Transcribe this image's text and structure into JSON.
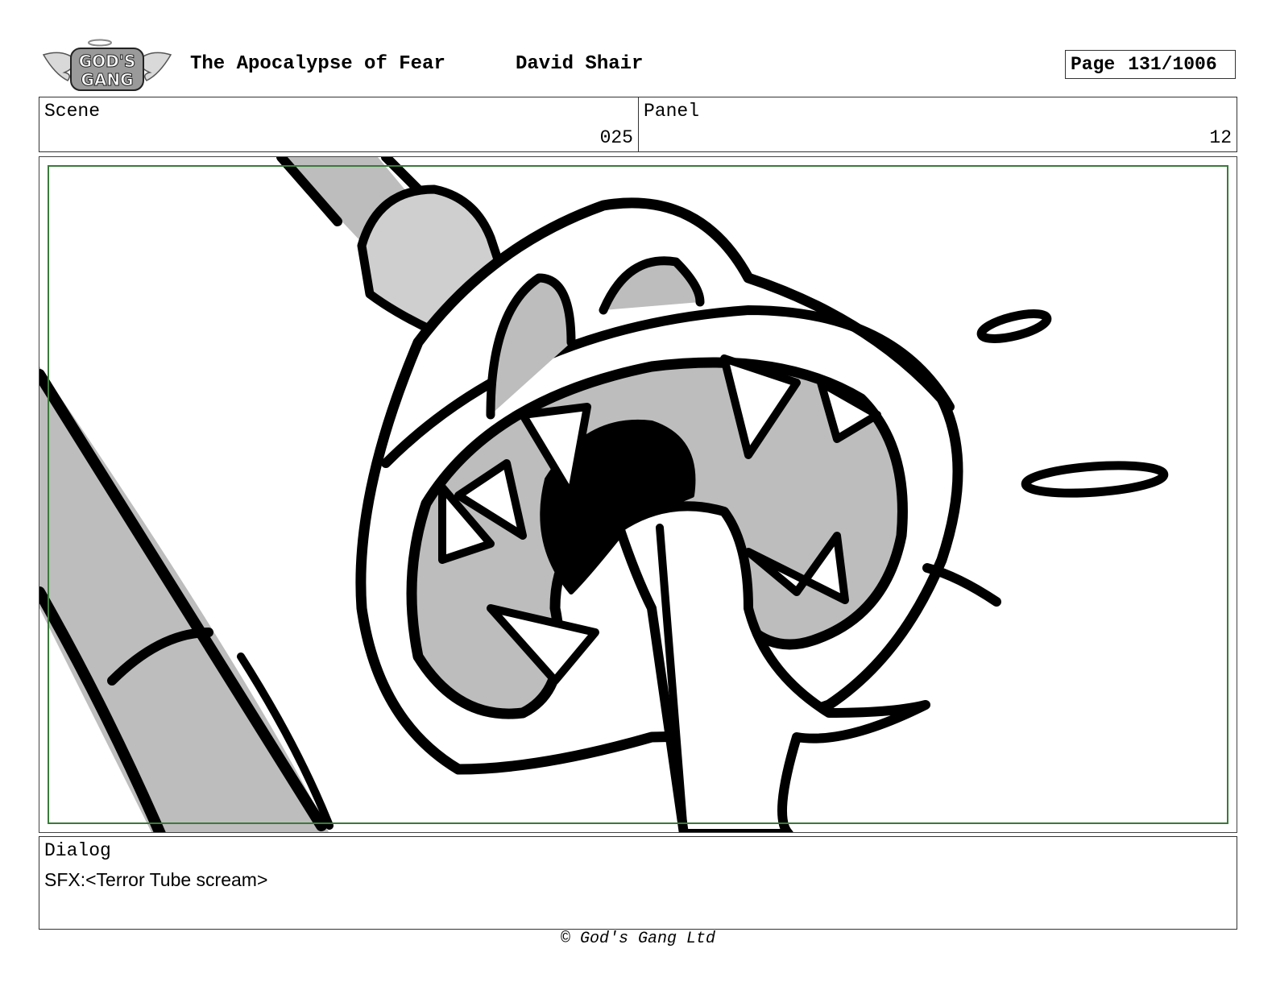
{
  "header": {
    "logo_text": "GOD'S GANG",
    "title": "The Apocalypse of Fear",
    "author": "David Shair",
    "page_label": "Page",
    "page_number": "131/1006"
  },
  "info": {
    "scene_label": "Scene",
    "scene_value": "025",
    "panel_label": "Panel",
    "panel_value": "12"
  },
  "dialog": {
    "label": "Dialog",
    "text": "SFX:<Terror Tube scream>"
  },
  "footer": {
    "copyright": "© God's Gang Ltd"
  }
}
